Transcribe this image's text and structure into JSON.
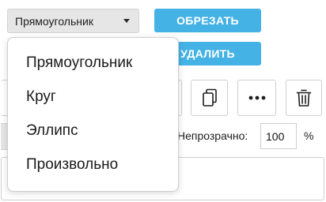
{
  "shape_select": {
    "value": "Прямоугольник",
    "icon": "chevron-down-icon"
  },
  "actions": {
    "crop_label": "ОБРЕЗАТЬ",
    "delete_label": "УДАЛИТЬ"
  },
  "toolbar": {
    "icons": [
      "flip-icon",
      "copy-icon",
      "more-icon",
      "trash-icon"
    ]
  },
  "opacity": {
    "label": "Непрозрачно:",
    "value": "100",
    "unit": "%"
  },
  "dropdown": {
    "items": [
      "Прямоугольник",
      "Круг",
      "Эллипс",
      "Произвольно"
    ]
  },
  "colors": {
    "accent": "#45b2e5",
    "select_bg": "#e6e6e6",
    "border": "#cfcfcf"
  }
}
